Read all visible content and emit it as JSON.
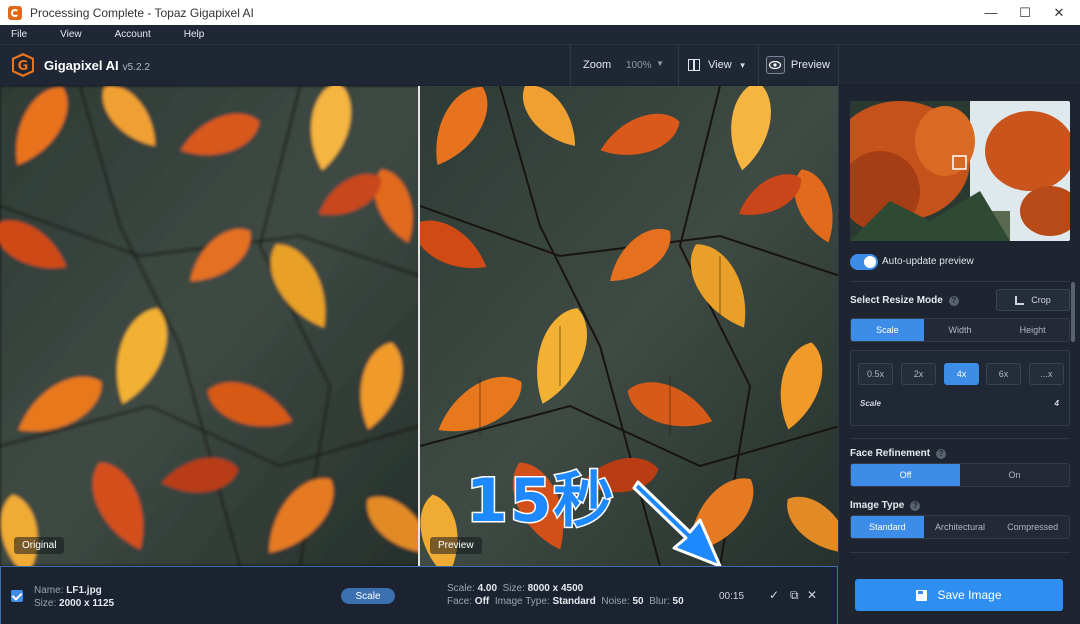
{
  "window": {
    "title": "Processing Complete - Topaz Gigapixel AI",
    "minimize": "—",
    "maximize": "☐",
    "close": "✕"
  },
  "menu": {
    "items": [
      "File",
      "View",
      "Account",
      "Help"
    ]
  },
  "header": {
    "logo_letter": "G",
    "app_name": "Gigapixel AI",
    "version": "v5.2.2",
    "zoom_label": "Zoom",
    "zoom_value": "100%",
    "view_label": "View",
    "preview_label": "Preview"
  },
  "canvas": {
    "left_label": "Original",
    "right_label": "Preview",
    "annotation": "15秒"
  },
  "panel": {
    "auto_update_label": "Auto-update preview",
    "resize_mode_title": "Select Resize Mode",
    "crop_label": "Crop",
    "resize_tabs": [
      "Scale",
      "Width",
      "Height"
    ],
    "scale_options": [
      "0.5x",
      "2x",
      "4x",
      "6x",
      "...x"
    ],
    "scale_label": "Scale",
    "scale_value": "4",
    "face_title": "Face Refinement",
    "face_options": [
      "Off",
      "On"
    ],
    "image_type_title": "Image Type",
    "image_type_options": [
      "Standard",
      "Architectural",
      "Compressed"
    ],
    "accent": "#3d8de8"
  },
  "bottom": {
    "name_label": "Name:",
    "name_value": "LF1.jpg",
    "size_label": "Size:",
    "size_value": "2000 x 1125",
    "mode_pill": "Scale",
    "scale_label": "Scale:",
    "scale_value": "4.00",
    "out_size_label": "Size:",
    "out_size_value": "8000 x 4500",
    "face_label": "Face:",
    "face_value": "Off",
    "type_label": "Image Type:",
    "type_value": "Standard",
    "noise_label": "Noise:",
    "noise_value": "50",
    "blur_label": "Blur:",
    "blur_value": "50",
    "timer": "00:15",
    "save_label": "Save Image"
  }
}
